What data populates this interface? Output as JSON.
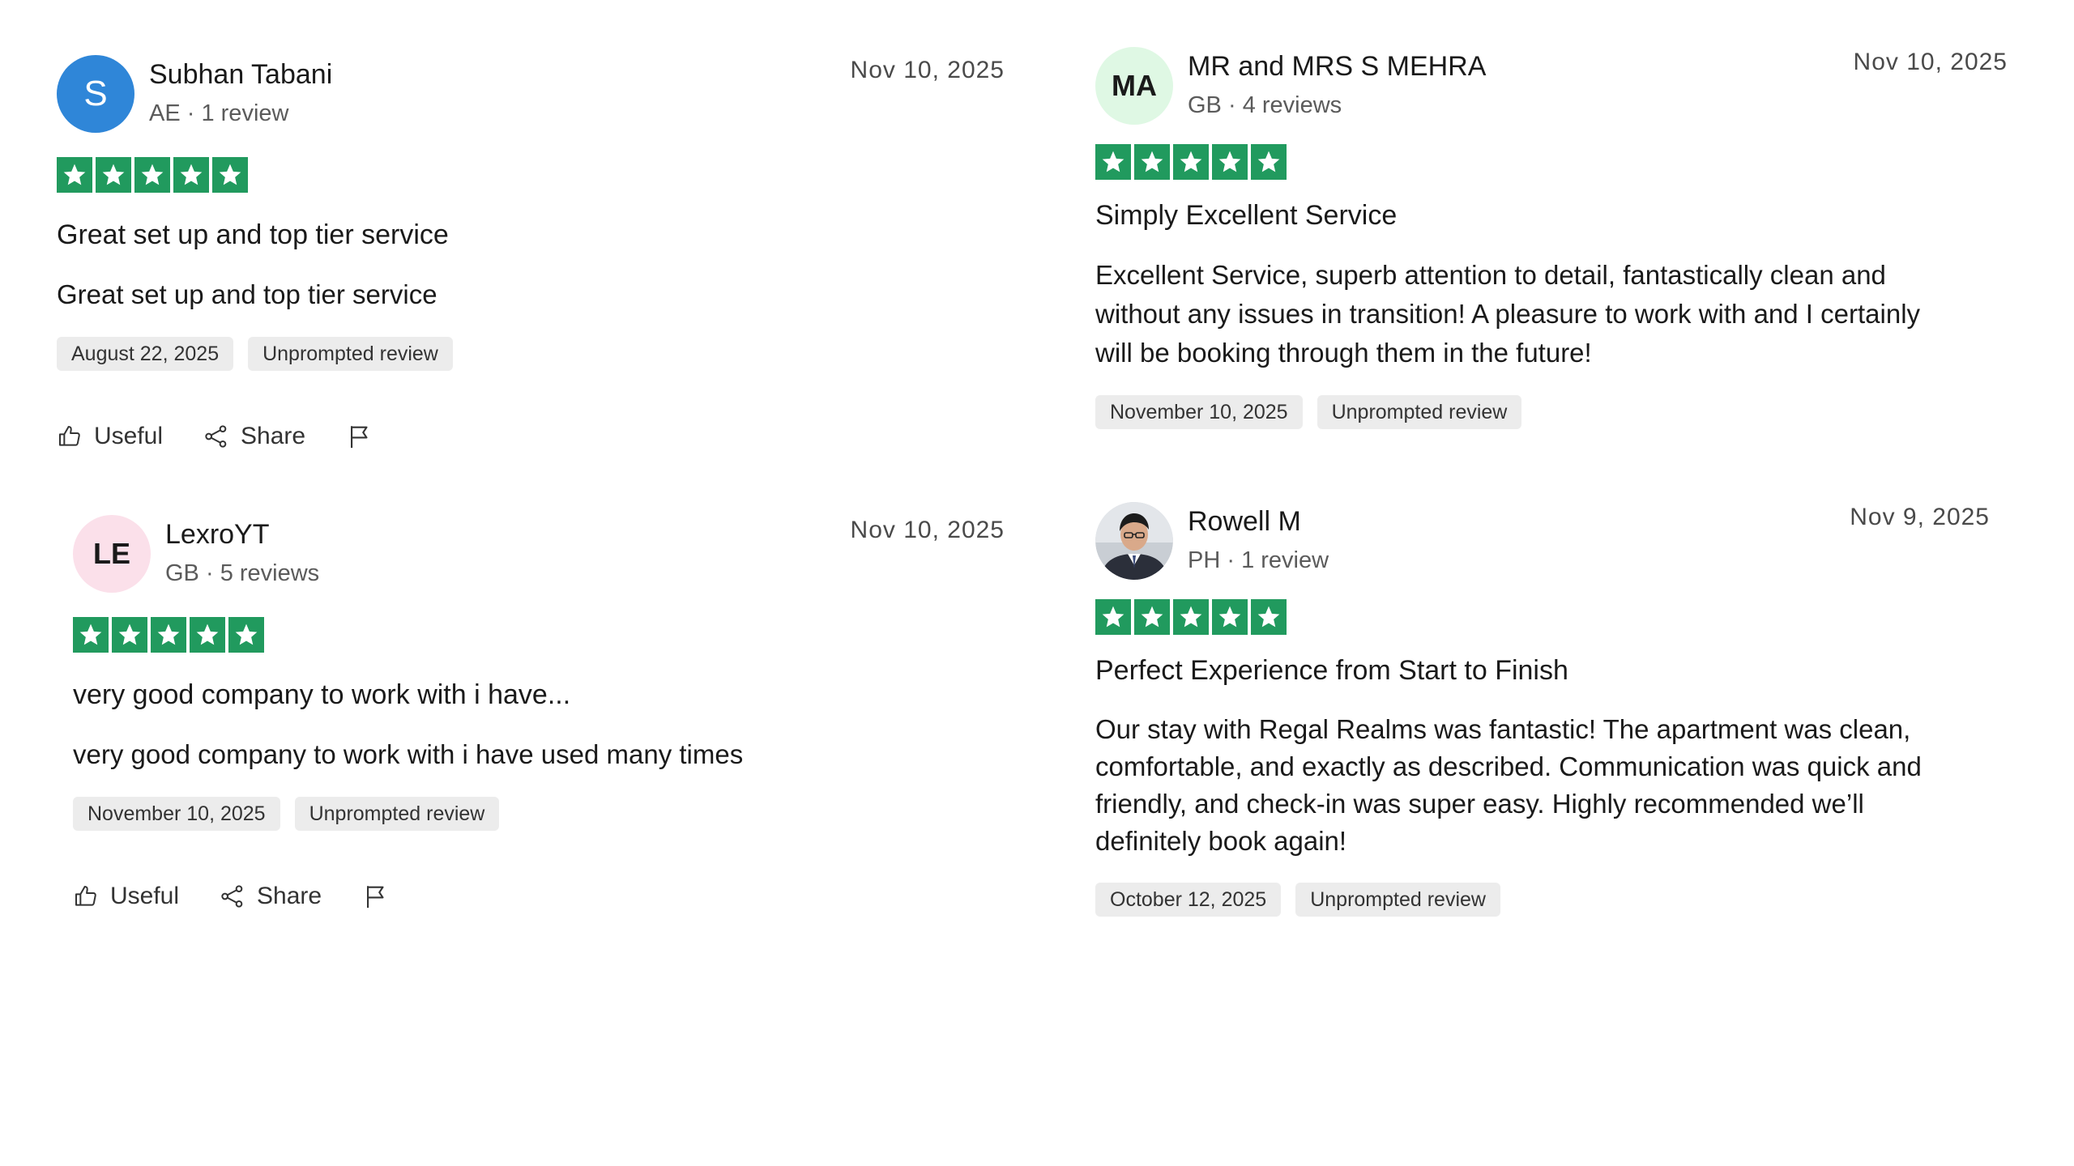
{
  "reviews": [
    {
      "name": "Subhan Tabani",
      "initials": "S",
      "country": "AE",
      "review_count": "1 review",
      "date": "Nov 10, 2025",
      "rating": 5,
      "title": "Great set up and top tier service",
      "text": "Great set up and top tier service",
      "experience_date": "August 22, 2025",
      "tag": "Unprompted review",
      "useful_label": "Useful",
      "share_label": "Share",
      "avatar_color": "#2f86d8"
    },
    {
      "name": "MR and MRS S MEHRA",
      "initials": "MA",
      "country": "GB",
      "review_count": "4 reviews",
      "date": "Nov 10, 2025",
      "rating": 5,
      "title": "Simply Excellent Service",
      "text_lines": [
        "Excellent Service, superb attention to detail, fantastically clean and",
        "without any issues in transition! A pleasure to work with and I certainly",
        "will be booking through them in the future!"
      ],
      "experience_date": "November 10, 2025",
      "tag": "Unprompted review",
      "avatar_color": "#dff8e4"
    },
    {
      "name": "LexroYT",
      "initials": "LE",
      "country": "GB",
      "review_count": "5 reviews",
      "date": "Nov 10, 2025",
      "rating": 5,
      "title": "very good company to work with i have...",
      "text": "very good company to work with i have used many times",
      "experience_date": "November 10, 2025",
      "tag": "Unprompted review",
      "useful_label": "Useful",
      "share_label": "Share",
      "avatar_color": "#fbe0ea"
    },
    {
      "name": "Rowell M",
      "country": "PH",
      "review_count": "1 review",
      "date": "Nov 9, 2025",
      "rating": 5,
      "title": "Perfect Experience from Start to Finish",
      "text_lines": [
        "Our stay with Regal Realms was fantastic! The apartment was clean,",
        "comfortable, and exactly as described. Communication was quick and",
        "friendly, and check-in was super easy. Highly recommended we’ll",
        "definitely book again!"
      ],
      "experience_date": "October 12, 2025",
      "tag": "Unprompted review"
    }
  ],
  "colors": {
    "star_green": "#219a5e",
    "tag_bg": "#ececec"
  },
  "icons": {
    "useful": "thumbs-up-icon",
    "share": "share-icon",
    "report": "flag-icon"
  }
}
